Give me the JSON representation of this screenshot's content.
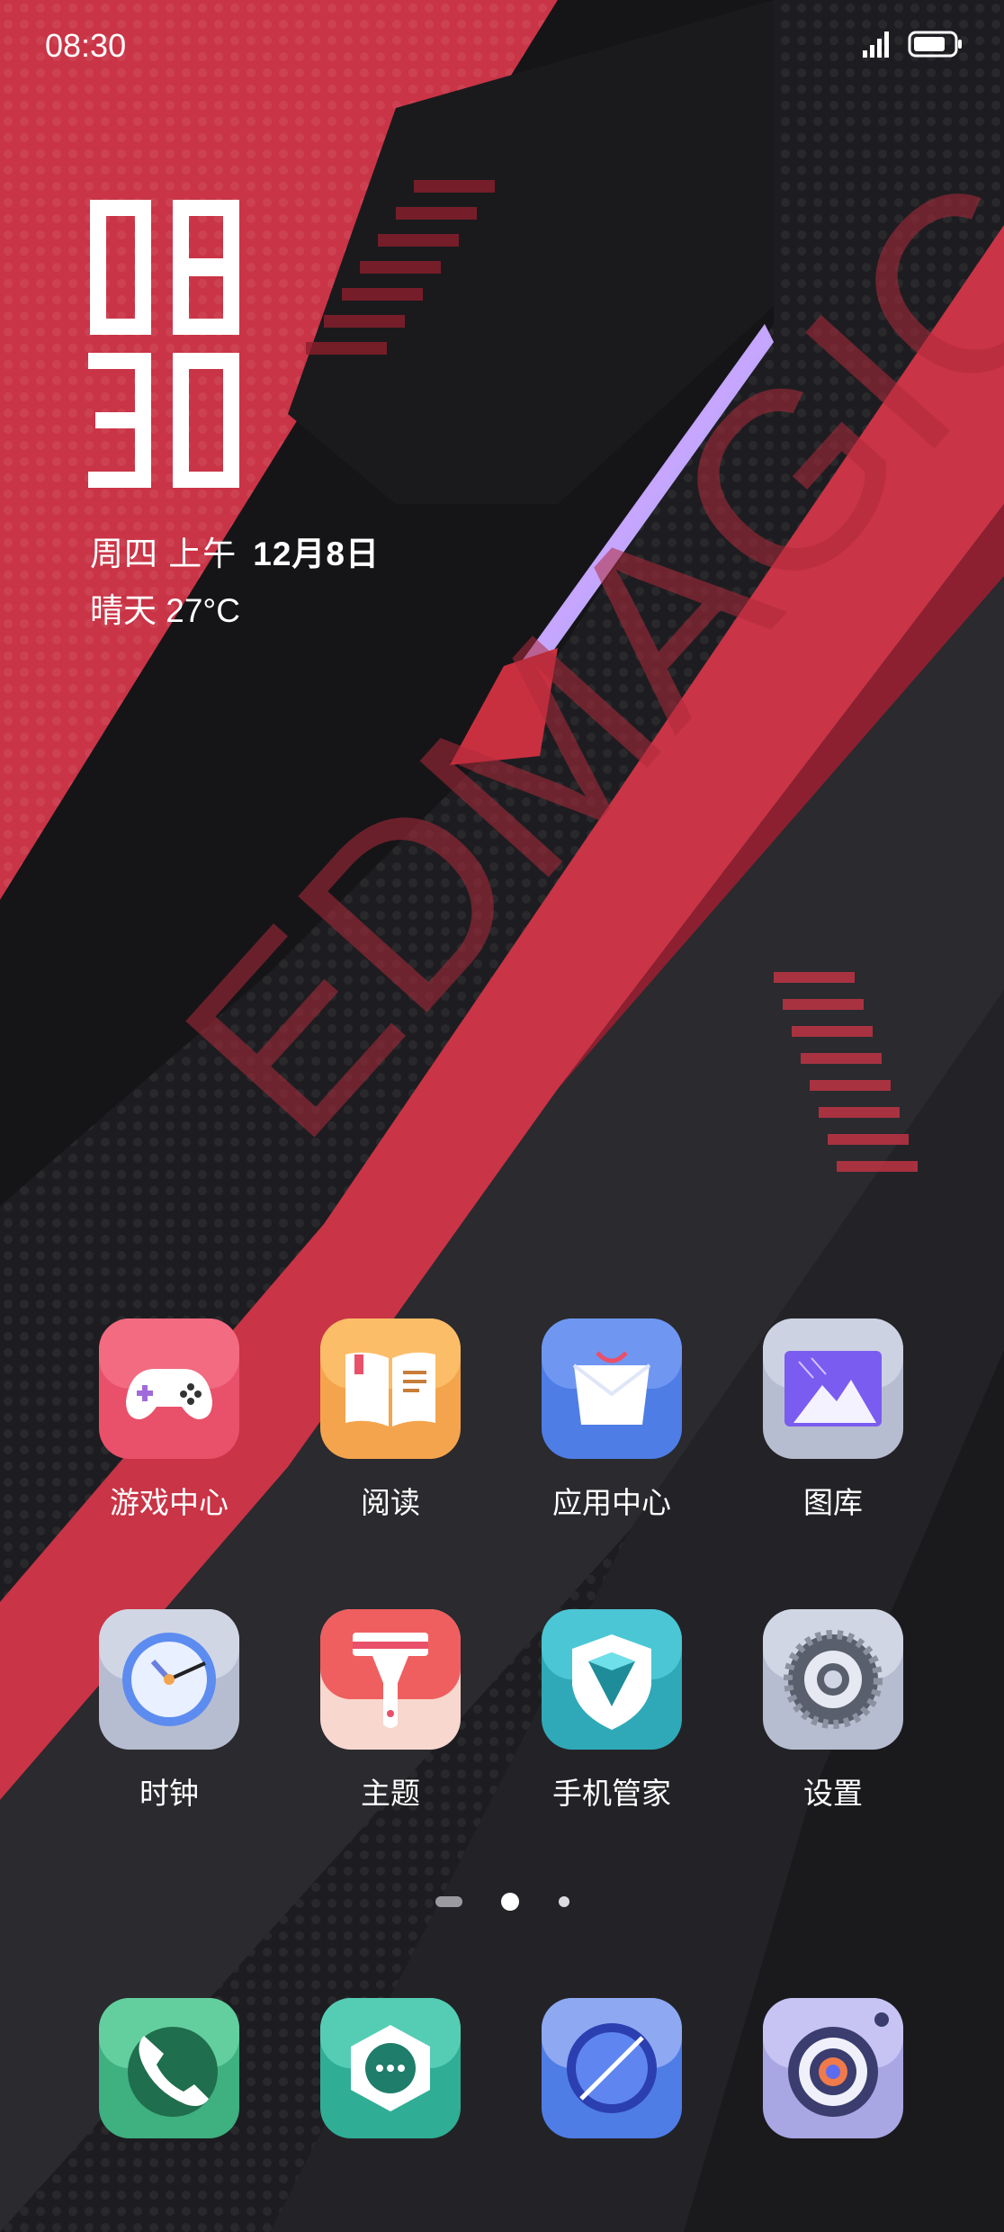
{
  "status_bar": {
    "time": "08:30",
    "signal_icon": "cell-signal-icon",
    "battery_icon": "battery-icon"
  },
  "clock_widget": {
    "hours": "08",
    "minutes": "30"
  },
  "date": {
    "weekday_period": "周四 上午",
    "month_day": "12月8日"
  },
  "weather": {
    "text": "晴天 27°C"
  },
  "apps_row1": [
    {
      "label": "游戏中心",
      "icon": "gamepad-icon"
    },
    {
      "label": "阅读",
      "icon": "book-icon"
    },
    {
      "label": "应用中心",
      "icon": "app-store-icon"
    },
    {
      "label": "图库",
      "icon": "gallery-icon"
    }
  ],
  "apps_row2": [
    {
      "label": "时钟",
      "icon": "clock-icon"
    },
    {
      "label": "主题",
      "icon": "paint-brush-icon"
    },
    {
      "label": "手机管家",
      "icon": "shield-icon"
    },
    {
      "label": "设置",
      "icon": "gear-icon"
    }
  ],
  "page_indicator": {
    "pages": 3,
    "current": 2
  },
  "dock": [
    {
      "icon": "phone-icon"
    },
    {
      "icon": "message-icon"
    },
    {
      "icon": "browser-icon"
    },
    {
      "icon": "camera-icon"
    }
  ],
  "colors": {
    "accent_red": "#d23a4c",
    "dark_bg": "#1c1c20"
  }
}
